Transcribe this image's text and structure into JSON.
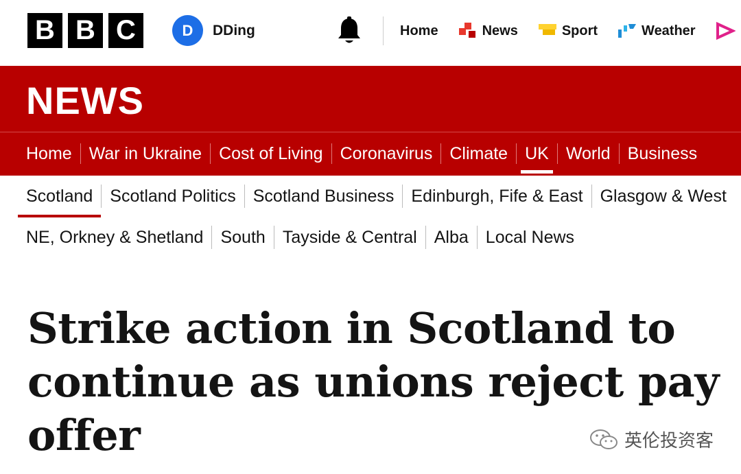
{
  "brand": {
    "letters": [
      "B",
      "B",
      "C"
    ]
  },
  "account": {
    "initial": "D",
    "name": "DDing",
    "avatar_color": "#1d6ee6"
  },
  "top_nav": [
    {
      "label": "Home",
      "icon": ""
    },
    {
      "label": "News",
      "icon": "news-icon",
      "color": "#e8382d"
    },
    {
      "label": "Sport",
      "icon": "sport-icon",
      "color": "#ffd230"
    },
    {
      "label": "Weather",
      "icon": "weather-icon",
      "color": "#1f8dd6"
    }
  ],
  "news_header": {
    "title": "NEWS",
    "band_color": "#b80000"
  },
  "main_nav": [
    {
      "label": "Home"
    },
    {
      "label": "War in Ukraine"
    },
    {
      "label": "Cost of Living"
    },
    {
      "label": "Coronavirus"
    },
    {
      "label": "Climate"
    },
    {
      "label": "UK",
      "active": true
    },
    {
      "label": "World"
    },
    {
      "label": "Business"
    }
  ],
  "sub_nav_row1": [
    {
      "label": "Scotland",
      "active": true
    },
    {
      "label": "Scotland Politics"
    },
    {
      "label": "Scotland Business"
    },
    {
      "label": "Edinburgh, Fife & East"
    },
    {
      "label": "Glasgow & West"
    }
  ],
  "sub_nav_row2": [
    {
      "label": "NE, Orkney & Shetland"
    },
    {
      "label": "South"
    },
    {
      "label": "Tayside & Central"
    },
    {
      "label": "Alba"
    },
    {
      "label": "Local News"
    }
  ],
  "article": {
    "headline": "Strike action in Scotland to continue as unions reject pay offer"
  },
  "watermark": {
    "text": "英伦投资客"
  }
}
